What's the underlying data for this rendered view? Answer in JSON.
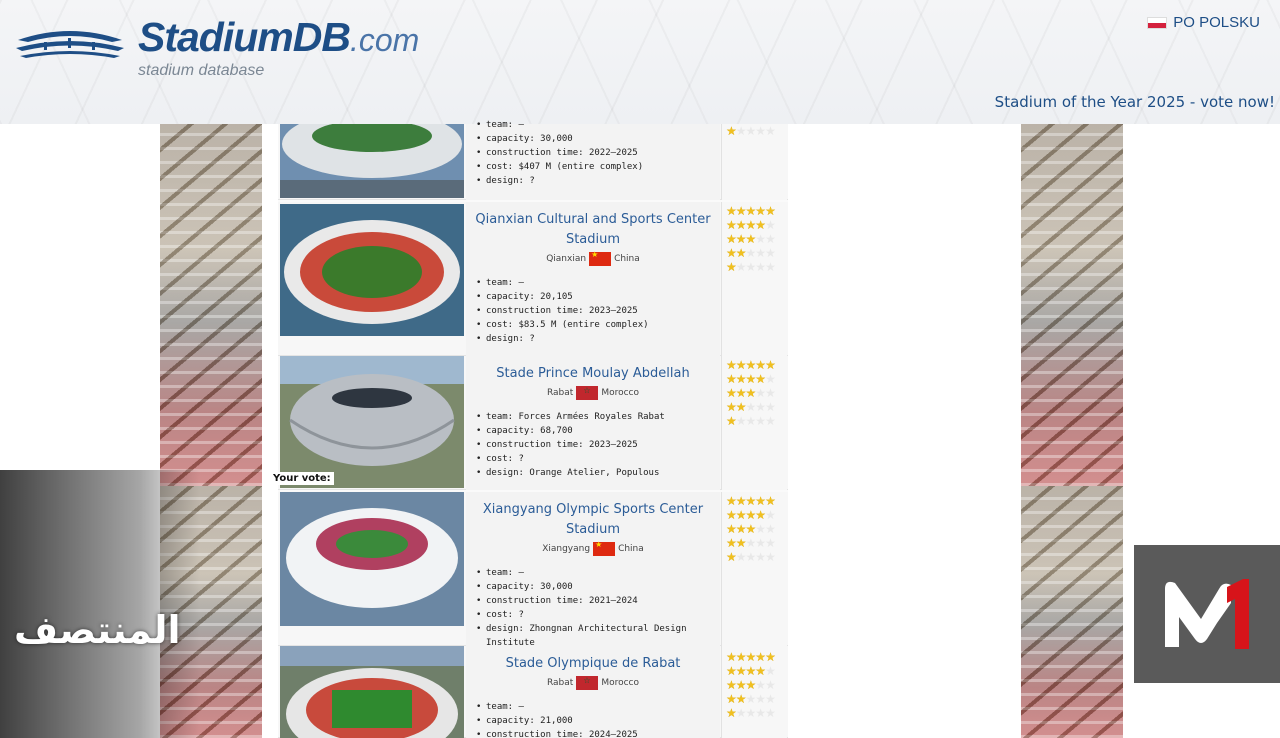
{
  "header": {
    "site_name": "StadiumDB",
    "site_tld": ".com",
    "tagline": "stadium database",
    "language_link": "PO POLSKU",
    "promo_link": "Stadium of the Year 2025 - vote now!"
  },
  "your_vote_label": "Your vote:",
  "overlays": {
    "arabic_channel": "المنتصف",
    "channel_logo": "M1"
  },
  "colors": {
    "link_blue": "#2b5c97",
    "brand_blue": "#1e4e86",
    "star_gold": "#f0c020"
  },
  "entries": [
    {
      "title": "",
      "city": "",
      "country": "",
      "facts": [
        "team: –",
        "capacity: 30,000",
        "construction time: 2022–2025",
        "cost: $407 M (entire complex)",
        "design: ?"
      ],
      "star_rows": [
        1
      ]
    },
    {
      "title": "Qianxian Cultural and Sports Center Stadium",
      "city": "Qianxian",
      "country": "China",
      "facts": [
        "team: –",
        "capacity: 20,105",
        "construction time: 2023–2025",
        "cost: $83.5 M (entire complex)",
        "design: ?"
      ],
      "star_rows": [
        5,
        4,
        3,
        2,
        1
      ]
    },
    {
      "title": "Stade Prince Moulay Abdellah",
      "city": "Rabat",
      "country": "Morocco",
      "facts": [
        "team: Forces Armées Royales Rabat",
        "capacity: 68,700",
        "construction time: 2023–2025",
        "cost: ?",
        "design: Orange Atelier, Populous"
      ],
      "star_rows": [
        5,
        4,
        3,
        2,
        1
      ]
    },
    {
      "title": "Xiangyang Olympic Sports Center Stadium",
      "city": "Xiangyang",
      "country": "China",
      "facts": [
        "team: –",
        "capacity: 30,000",
        "construction time: 2021–2024",
        "cost: ?",
        "design: Zhongnan Architectural Design Institute"
      ],
      "star_rows": [
        5,
        4,
        3,
        2,
        1
      ]
    },
    {
      "title": "Stade Olympique de Rabat",
      "city": "Rabat",
      "country": "Morocco",
      "facts": [
        "team: –",
        "capacity: 21,000",
        "construction time: 2024–2025"
      ],
      "star_rows": [
        5,
        4,
        3,
        2,
        1
      ]
    }
  ]
}
